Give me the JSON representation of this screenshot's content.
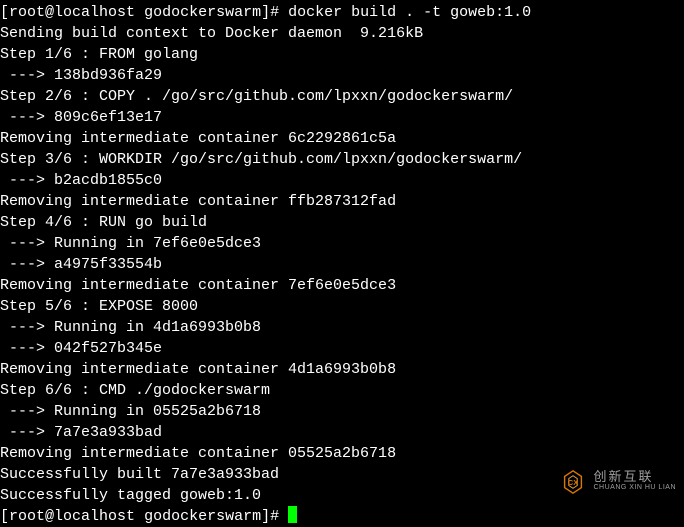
{
  "prompt1": {
    "user": "root",
    "host": "localhost",
    "dir": "godockerswarm",
    "command": "docker build . -t goweb:1.0"
  },
  "lines": [
    "Sending build context to Docker daemon  9.216kB",
    "Step 1/6 : FROM golang",
    " ---> 138bd936fa29",
    "Step 2/6 : COPY . /go/src/github.com/lpxxn/godockerswarm/",
    " ---> 809c6ef13e17",
    "Removing intermediate container 6c2292861c5a",
    "Step 3/6 : WORKDIR /go/src/github.com/lpxxn/godockerswarm/",
    " ---> b2acdb1855c0",
    "Removing intermediate container ffb287312fad",
    "Step 4/6 : RUN go build",
    " ---> Running in 7ef6e0e5dce3",
    " ---> a4975f33554b",
    "Removing intermediate container 7ef6e0e5dce3",
    "Step 5/6 : EXPOSE 8000",
    " ---> Running in 4d1a6993b0b8",
    " ---> 042f527b345e",
    "Removing intermediate container 4d1a6993b0b8",
    "Step 6/6 : CMD ./godockerswarm",
    " ---> Running in 05525a2b6718",
    " ---> 7a7e3a933bad",
    "Removing intermediate container 05525a2b6718",
    "Successfully built 7a7e3a933bad",
    "Successfully tagged goweb:1.0"
  ],
  "prompt2": {
    "user": "root",
    "host": "localhost",
    "dir": "godockerswarm"
  },
  "watermark": {
    "cn": "创新互联",
    "en": "CHUANG XIN HU LIAN"
  }
}
